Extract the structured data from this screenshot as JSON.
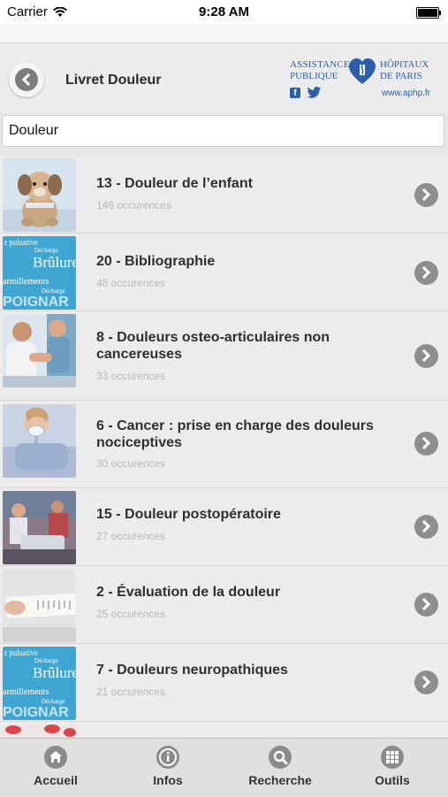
{
  "status_bar": {
    "carrier": "Carrier",
    "time": "9:28 AM"
  },
  "header": {
    "title": "Livret Douleur",
    "logo": {
      "line1_left": "ASSISTANCE",
      "line2_left": "PUBLIQUE",
      "line1_right": "HÔPITAUX",
      "line2_right": "DE PARIS",
      "website": "www.aphp.fr"
    }
  },
  "search": {
    "value": "Douleur"
  },
  "results": [
    {
      "title": "13 - Douleur de l’enfant",
      "count": "146 occurences",
      "thumb": "teddy-bear"
    },
    {
      "title": "20 - Bibliographie",
      "count": "48 occurences",
      "thumb": "text-card"
    },
    {
      "title": "8 - Douleurs osteo-articulaires non cancereuses",
      "count": "33 occurences",
      "thumb": "doctor-patient"
    },
    {
      "title": "6 - Cancer : prise en charge des douleurs nociceptives",
      "count": "30 occurences",
      "thumb": "patient-mask"
    },
    {
      "title": "15 - Douleur postopératoire",
      "count": "27 occurences",
      "thumb": "operating-room"
    },
    {
      "title": "2 - Évaluation de la douleur",
      "count": "25 occurences",
      "thumb": "pain-ruler"
    },
    {
      "title": "7 - Douleurs neuropathiques",
      "count": "21 occurences",
      "thumb": "text-card"
    }
  ],
  "thumb_card_text": {
    "top": "r pulsative",
    "small1": "Décharge",
    "big": "Brûlure",
    "mid": "armillements",
    "small2": "Décharge",
    "bottom": "POIGNAR"
  },
  "tabbar": {
    "home": "Accueil",
    "info": "Infos",
    "search": "Recherche",
    "tools": "Outils"
  },
  "colors": {
    "brand_blue": "#2c5fa8",
    "chevron_gray": "#8e8e8e",
    "card_blue": "#3fa6d4"
  }
}
